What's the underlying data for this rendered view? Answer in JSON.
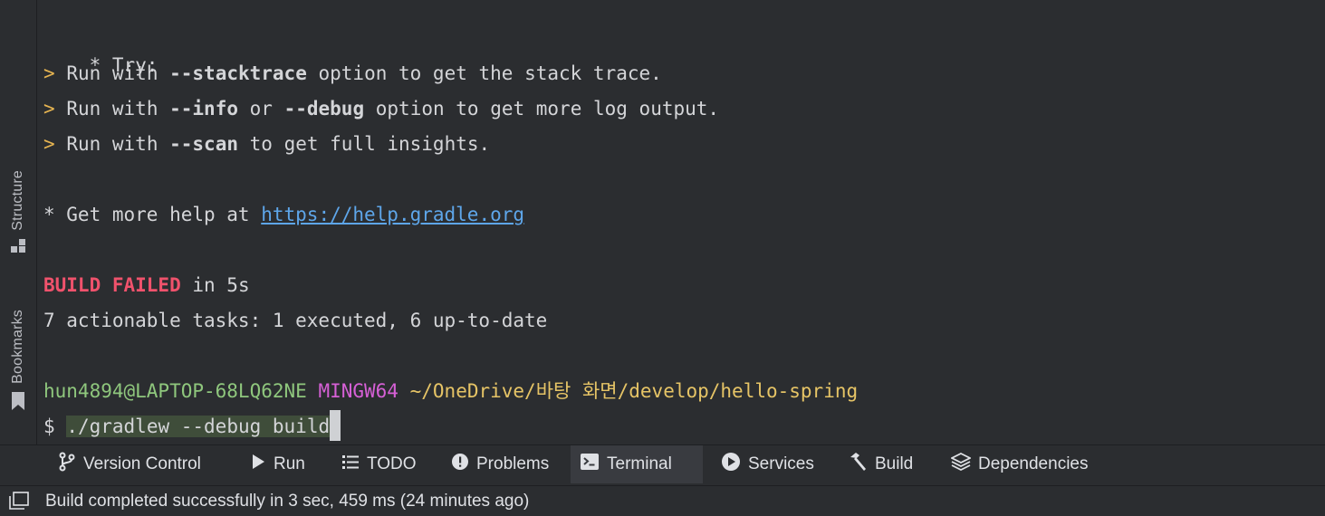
{
  "side_tools": {
    "structure_label": "Structure",
    "bookmarks_label": "Bookmarks"
  },
  "terminal": {
    "try_line": "* Try:",
    "arrow": ">",
    "run_with": "Run with",
    "stacktrace_flag": "--stacktrace",
    "stacktrace_rest": "option to get the stack trace.",
    "info_flag": "--info",
    "or_text": "or",
    "debug_flag": "--debug",
    "debug_rest": "option to get more log output.",
    "scan_flag": "--scan",
    "scan_rest": "to get full insights.",
    "help_prefix": "* Get more help at",
    "help_link": "https://help.gradle.org",
    "build_failed": "BUILD FAILED",
    "build_time": "in 5s",
    "tasks_line": "7 actionable tasks: 1 executed, 6 up-to-date",
    "prompt_user": "hun4894@LAPTOP-68LQ62NE",
    "prompt_shell": "MINGW64",
    "prompt_path": "~/OneDrive/바탕 화면/develop/hello-spring",
    "prompt_symbol": "$",
    "command": "./gradlew --debug build"
  },
  "tool_tabs": {
    "version_control": "Version Control",
    "run": "Run",
    "todo": "TODO",
    "problems": "Problems",
    "terminal": "Terminal",
    "services": "Services",
    "build": "Build",
    "dependencies": "Dependencies"
  },
  "status": {
    "message": "Build completed successfully in 3 sec, 459 ms (24 minutes ago)"
  }
}
